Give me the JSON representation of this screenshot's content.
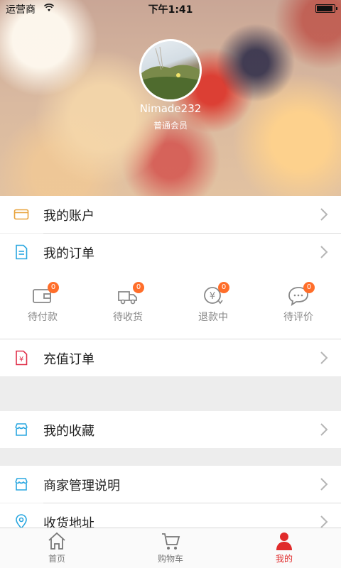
{
  "status_bar": {
    "carrier": "运营商",
    "time": "下午1:41",
    "battery_level": 0.9
  },
  "profile": {
    "username": "Nimade232",
    "level": "普通会员"
  },
  "menu": {
    "account": {
      "label": "我的账户",
      "icon": "card-icon"
    },
    "orders": {
      "label": "我的订单",
      "icon": "document-icon"
    },
    "order_statuses": [
      {
        "label": "待付款",
        "count": "0",
        "icon": "wallet-icon"
      },
      {
        "label": "待收货",
        "count": "0",
        "icon": "truck-icon"
      },
      {
        "label": "退款中",
        "count": "0",
        "icon": "refund-icon"
      },
      {
        "label": "待评价",
        "count": "0",
        "icon": "comment-icon"
      }
    ],
    "recharge": {
      "label": "充值订单",
      "icon": "recharge-icon"
    },
    "favorites": {
      "label": "我的收藏",
      "icon": "store-icon"
    },
    "merchant": {
      "label": "商家管理说明",
      "icon": "store-icon"
    },
    "address": {
      "label": "收货地址",
      "icon": "location-icon"
    }
  },
  "tabbar": {
    "home": "首页",
    "cart": "购物车",
    "mine": "我的"
  },
  "colors": {
    "accent_red": "#e02b2b",
    "badge_orange": "#ff6e2a",
    "icon_blue": "#2aa7e0",
    "icon_orange": "#e8a23a"
  }
}
